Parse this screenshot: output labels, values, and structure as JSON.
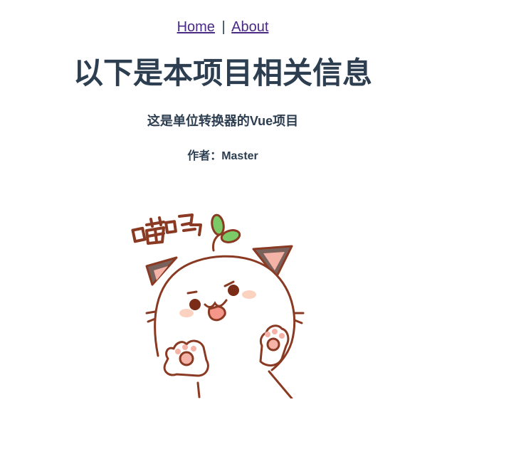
{
  "nav": {
    "home_label": "Home",
    "separator": "|",
    "about_label": "About"
  },
  "page": {
    "title": "以下是本项目相关信息",
    "subtitle": "这是单位转换器的Vue项目",
    "author": "作者：Master"
  },
  "sticker": {
    "icon": "cat-sticker",
    "caption": "喵呜"
  },
  "colors": {
    "text": "#2c3e50",
    "link": "#4b2a85",
    "cat_outline": "#8a3a22",
    "cat_ear": "#7a625c",
    "leaf": "#7cc968"
  }
}
